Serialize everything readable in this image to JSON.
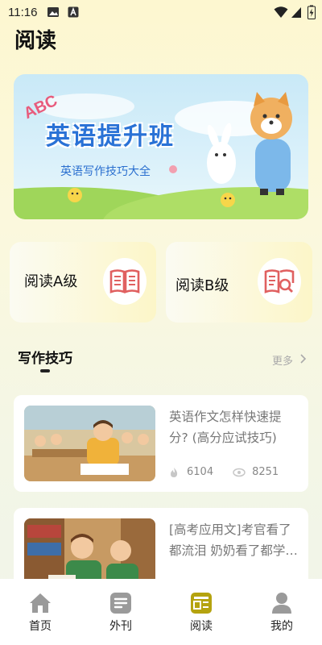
{
  "status_bar": {
    "time": "11:16"
  },
  "page": {
    "title": "阅读"
  },
  "banner": {
    "logo_text": "ABC",
    "headline": "英语提升班",
    "subtitle": "英语写作技巧大全"
  },
  "levels": [
    {
      "label": "阅读A级",
      "icon": "open-book-icon"
    },
    {
      "label": "阅读B级",
      "icon": "book-search-icon"
    }
  ],
  "section": {
    "title": "写作技巧",
    "more": "更多"
  },
  "articles": [
    {
      "title": "英语作文怎样快速提分? (高分应试技巧)",
      "likes": "6104",
      "views": "8251"
    },
    {
      "title": "[高考应用文]考官看了都流泪 奶奶看了都学…",
      "likes": "",
      "views": ""
    }
  ],
  "tabs": [
    {
      "label": "首页",
      "icon": "home-icon",
      "active": false
    },
    {
      "label": "外刊",
      "icon": "magazine-icon",
      "active": false
    },
    {
      "label": "阅读",
      "icon": "reading-icon",
      "active": true
    },
    {
      "label": "我的",
      "icon": "profile-icon",
      "active": false
    }
  ],
  "colors": {
    "accent": "#b5a30f",
    "tab_inactive": "#9a9a9a",
    "book_red": "#e06060"
  }
}
